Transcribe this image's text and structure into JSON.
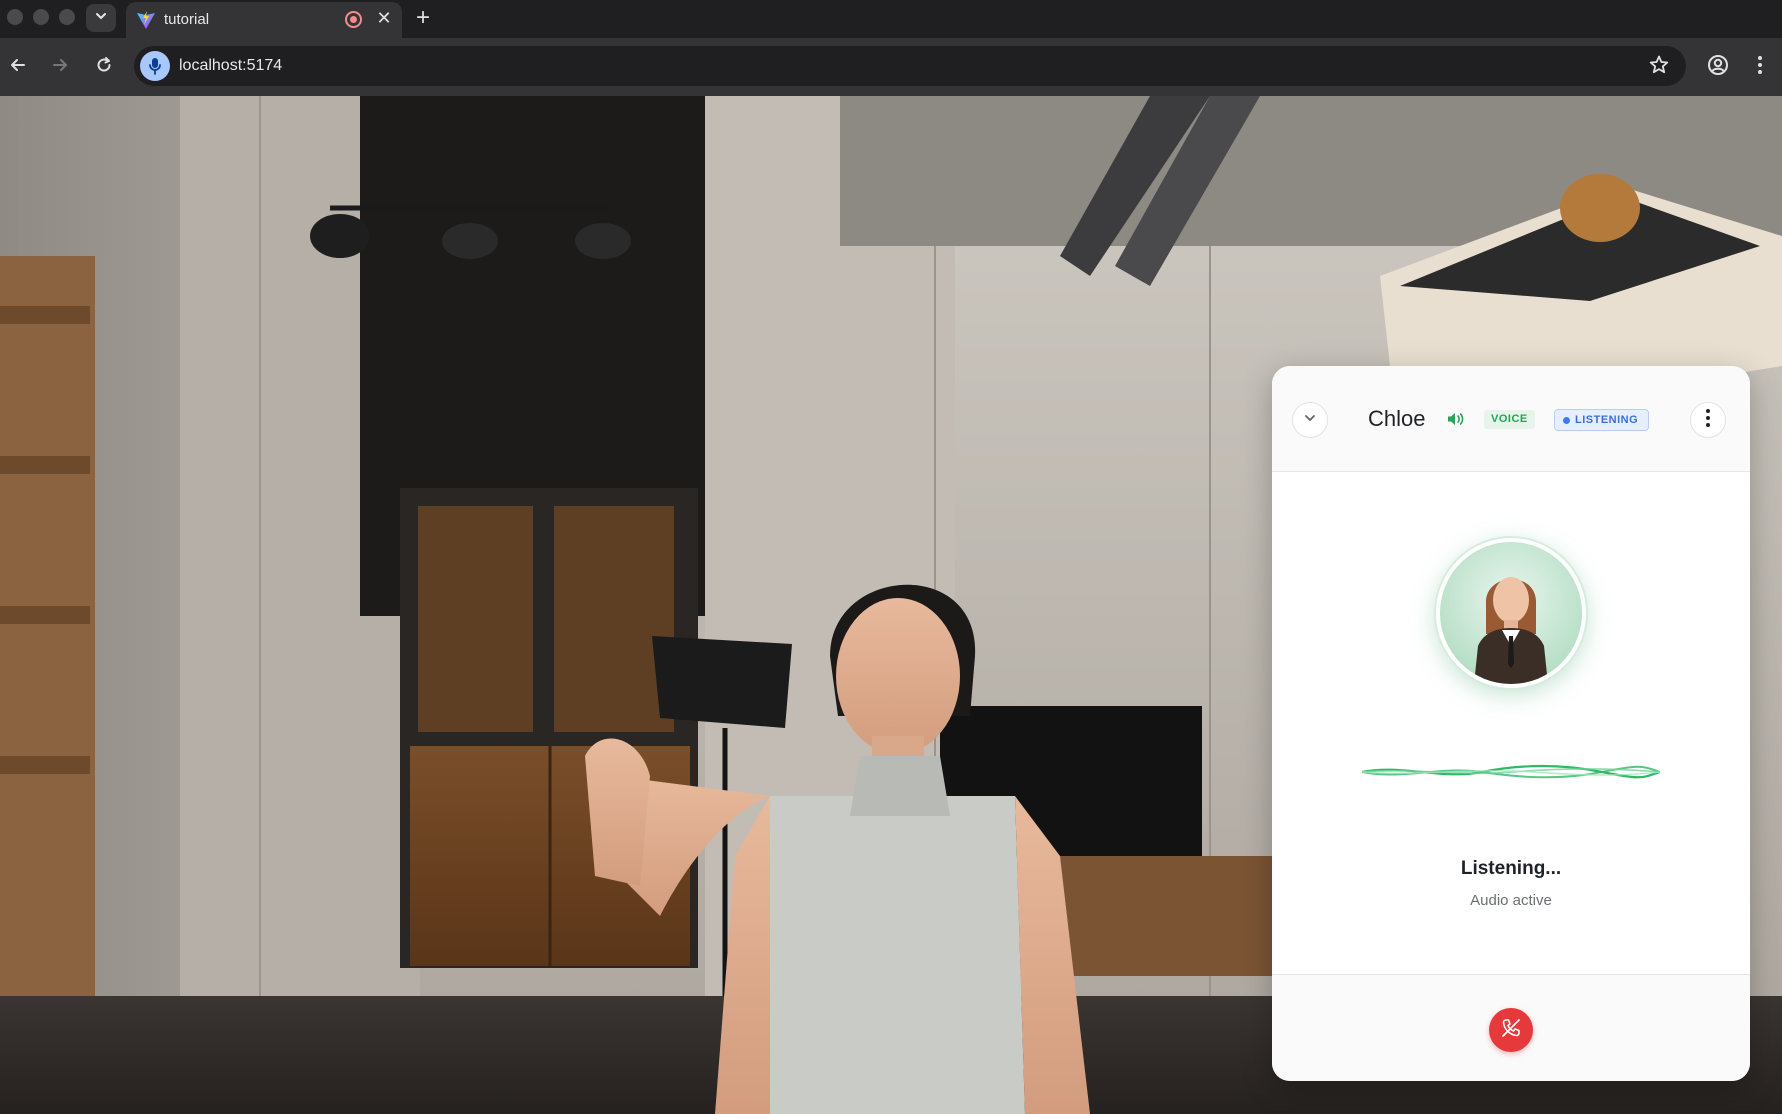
{
  "browser": {
    "tab_title": "tutorial",
    "url": "localhost:5174",
    "icons": {
      "tab_search": "chevron-down-icon",
      "favicon": "vite-icon",
      "recording": "recording-icon",
      "close": "close-icon",
      "new_tab": "plus-icon",
      "back": "arrow-left-icon",
      "forward": "arrow-right-icon",
      "reload": "reload-icon",
      "mic": "microphone-icon",
      "bookmark": "star-icon",
      "profile": "profile-icon",
      "menu": "kebab-menu-icon"
    },
    "tab_close_glyph": "✕",
    "new_tab_glyph": "+"
  },
  "panel": {
    "agent_name": "Chloe",
    "voice_badge": "VOICE",
    "listening_badge": "LISTENING",
    "status_title": "Listening...",
    "status_subtitle": "Audio active",
    "icons": {
      "collapse": "chevron-down-icon",
      "speaker": "speaker-icon",
      "more": "vertical-dots-icon",
      "hangup": "phone-hangup-icon"
    },
    "colors": {
      "voice_badge_text": "#27a35a",
      "listening_badge_text": "#3b6fd8",
      "waveform": "#2fb866",
      "hangup": "#e5393c"
    }
  }
}
